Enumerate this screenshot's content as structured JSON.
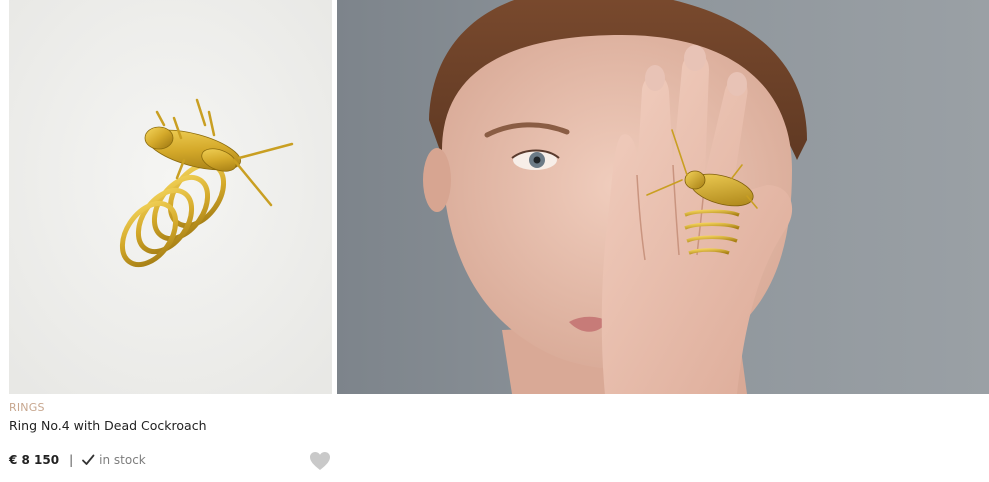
{
  "product": {
    "category": "RINGS",
    "title": "Ring No.4 with Dead Cockroach",
    "price": "€ 8 150",
    "separator": "|",
    "stock_status": "in stock",
    "icons": {
      "check": "check-icon",
      "wishlist": "heart-icon"
    }
  },
  "colors": {
    "category_text": "#c7a68e",
    "gold": "#d4a92a",
    "heart": "#c9c9c9",
    "product_bg": "#efefed",
    "model_bg": "#8a9096"
  }
}
